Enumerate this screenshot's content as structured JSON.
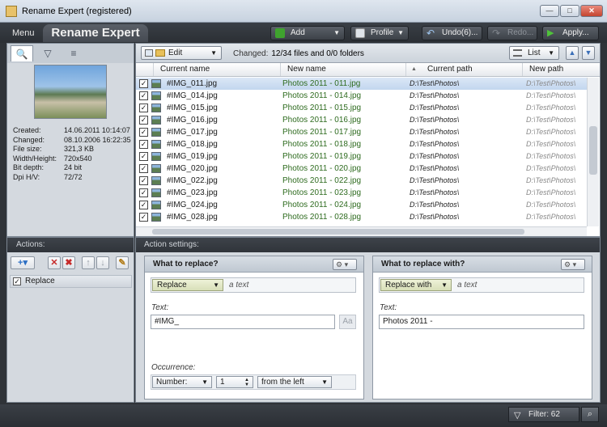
{
  "window": {
    "title": "Rename Expert (registered)"
  },
  "toolbar": {
    "menu_label": "Menu",
    "brand": "Rename Expert",
    "add_label": "Add",
    "profile_label": "Profile",
    "undo_label": "Undo(6)...",
    "redo_label": "Redo...",
    "apply_label": "Apply..."
  },
  "file_info": {
    "created_label": "Created:",
    "created": "14.06.2011 10:14:07",
    "changed_label": "Changed:",
    "changed": "08.10.2006 16:22:35",
    "filesize_label": "File size:",
    "filesize": "321,3 KB",
    "dims_label": "Width/Height:",
    "dims": "720x540",
    "bitdepth_label": "Bit depth:",
    "bitdepth": "24 bit",
    "dpi_label": "Dpi H/V:",
    "dpi": "72/72"
  },
  "grid": {
    "edit_label": "Edit",
    "changed_label": "Changed:",
    "changed_value": "12/34 files and 0/0 folders",
    "view_label": "List",
    "columns": [
      "Current name",
      "New name",
      "Current path",
      "New path"
    ],
    "rows": [
      {
        "current": "#IMG_011.jpg",
        "new": "Photos 2011 - 011.jpg",
        "cpath": "D:\\Test\\Photos\\",
        "npath": "D:\\Test\\Photos\\"
      },
      {
        "current": "#IMG_014.jpg",
        "new": "Photos 2011 - 014.jpg",
        "cpath": "D:\\Test\\Photos\\",
        "npath": "D:\\Test\\Photos\\"
      },
      {
        "current": "#IMG_015.jpg",
        "new": "Photos 2011 - 015.jpg",
        "cpath": "D:\\Test\\Photos\\",
        "npath": "D:\\Test\\Photos\\"
      },
      {
        "current": "#IMG_016.jpg",
        "new": "Photos 2011 - 016.jpg",
        "cpath": "D:\\Test\\Photos\\",
        "npath": "D:\\Test\\Photos\\"
      },
      {
        "current": "#IMG_017.jpg",
        "new": "Photos 2011 - 017.jpg",
        "cpath": "D:\\Test\\Photos\\",
        "npath": "D:\\Test\\Photos\\"
      },
      {
        "current": "#IMG_018.jpg",
        "new": "Photos 2011 - 018.jpg",
        "cpath": "D:\\Test\\Photos\\",
        "npath": "D:\\Test\\Photos\\"
      },
      {
        "current": "#IMG_019.jpg",
        "new": "Photos 2011 - 019.jpg",
        "cpath": "D:\\Test\\Photos\\",
        "npath": "D:\\Test\\Photos\\"
      },
      {
        "current": "#IMG_020.jpg",
        "new": "Photos 2011 - 020.jpg",
        "cpath": "D:\\Test\\Photos\\",
        "npath": "D:\\Test\\Photos\\"
      },
      {
        "current": "#IMG_022.jpg",
        "new": "Photos 2011 - 022.jpg",
        "cpath": "D:\\Test\\Photos\\",
        "npath": "D:\\Test\\Photos\\"
      },
      {
        "current": "#IMG_023.jpg",
        "new": "Photos 2011 - 023.jpg",
        "cpath": "D:\\Test\\Photos\\",
        "npath": "D:\\Test\\Photos\\"
      },
      {
        "current": "#IMG_024.jpg",
        "new": "Photos 2011 - 024.jpg",
        "cpath": "D:\\Test\\Photos\\",
        "npath": "D:\\Test\\Photos\\"
      },
      {
        "current": "#IMG_028.jpg",
        "new": "Photos 2011 - 028.jpg",
        "cpath": "D:\\Test\\Photos\\",
        "npath": "D:\\Test\\Photos\\"
      }
    ]
  },
  "actions": {
    "header": "Actions:",
    "items": [
      {
        "label": "Replace",
        "checked": true
      }
    ]
  },
  "settings": {
    "header": "Action settings:",
    "what_to_replace": {
      "title": "What to replace?",
      "mode": "Replace",
      "mode_hint": "a text",
      "text_label": "Text:",
      "text_value": "#IMG_",
      "case_button": "Aa",
      "occurrence_label": "Occurrence:",
      "occurrence_type": "Number:",
      "occurrence_number": "1",
      "occurrence_direction": "from the left"
    },
    "replace_with": {
      "title": "What to replace with?",
      "mode": "Replace with",
      "mode_hint": "a text",
      "text_label": "Text:",
      "text_value": "Photos 2011 -"
    }
  },
  "status": {
    "filter_label": "Filter: 62"
  }
}
